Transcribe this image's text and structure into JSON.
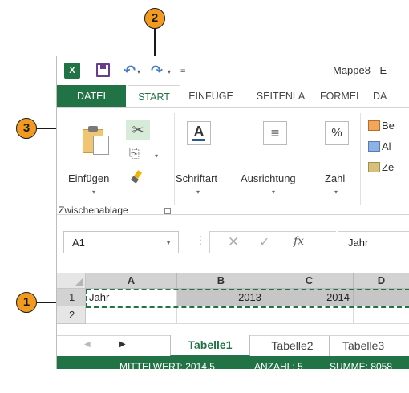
{
  "titlebar": {
    "title": "Mappe8 - E",
    "undo_drop": "▾",
    "redo_drop": "▾",
    "customize": "="
  },
  "tabs": {
    "file": "DATEI",
    "start": "START",
    "einfuege": "EINFÜGE",
    "seitenla": "SEITENLA",
    "formel": "FORMEL",
    "da": "DA"
  },
  "ribbon": {
    "paste_label": "Einfügen",
    "clipboard_group": "Zwischenablage",
    "font_label": "Schriftart",
    "align_label": "Ausrichtung",
    "number_label": "Zahl",
    "styles": [
      "Be",
      "Al",
      "Ze"
    ]
  },
  "formula_bar": {
    "name_box": "A1",
    "separator": "⋮",
    "fx": "fx",
    "value": "Jahr"
  },
  "grid": {
    "columns": [
      "A",
      "B",
      "C",
      "D"
    ],
    "rows": [
      {
        "header": "1",
        "cells": [
          "Jahr",
          "2013",
          "2014",
          ""
        ]
      },
      {
        "header": "2",
        "cells": [
          "",
          "",
          "",
          ""
        ]
      }
    ]
  },
  "sheets": {
    "tabs": [
      "Tabelle1",
      "Tabelle2",
      "Tabelle3"
    ],
    "active": "Tabelle1"
  },
  "status": {
    "average": "MITTELWERT: 2014,5",
    "count": "ANZAHL: 5",
    "sum": "SUMME: 8058"
  },
  "callouts": [
    "1",
    "2",
    "3"
  ],
  "colors": {
    "excel_green": "#217346",
    "callout_orange": "#f29a1f",
    "selected_header": "#d2d2d2"
  }
}
